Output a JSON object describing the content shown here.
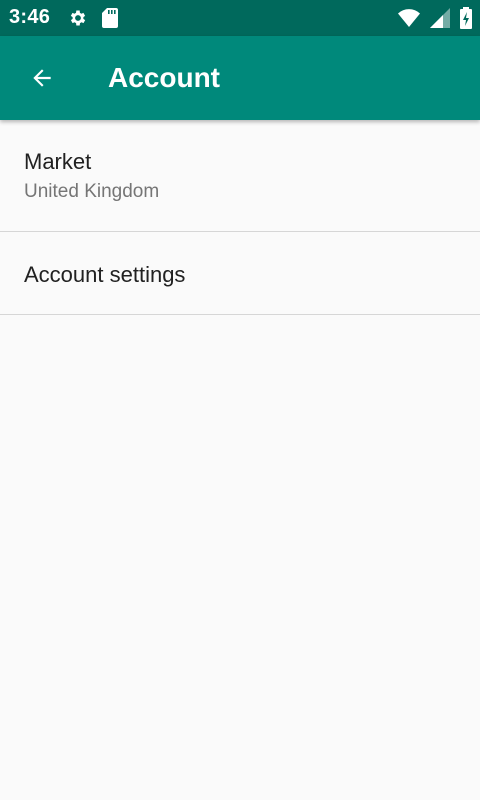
{
  "status_bar": {
    "time": "3:46",
    "left_icons": [
      "gear-icon",
      "sd-card-icon"
    ],
    "right_icons": [
      "wifi-icon",
      "cell-signal-icon",
      "battery-charging-icon"
    ]
  },
  "app_bar": {
    "back_icon": "arrow-back-icon",
    "title": "Account",
    "color": "#00897b"
  },
  "preferences": {
    "market": {
      "title": "Market",
      "summary": "United Kingdom"
    },
    "account_settings": {
      "title": "Account settings"
    }
  },
  "colors": {
    "status_bar": "#00695c",
    "app_bar": "#00897b",
    "background": "#fafafa",
    "divider": "#d6d6d6"
  }
}
